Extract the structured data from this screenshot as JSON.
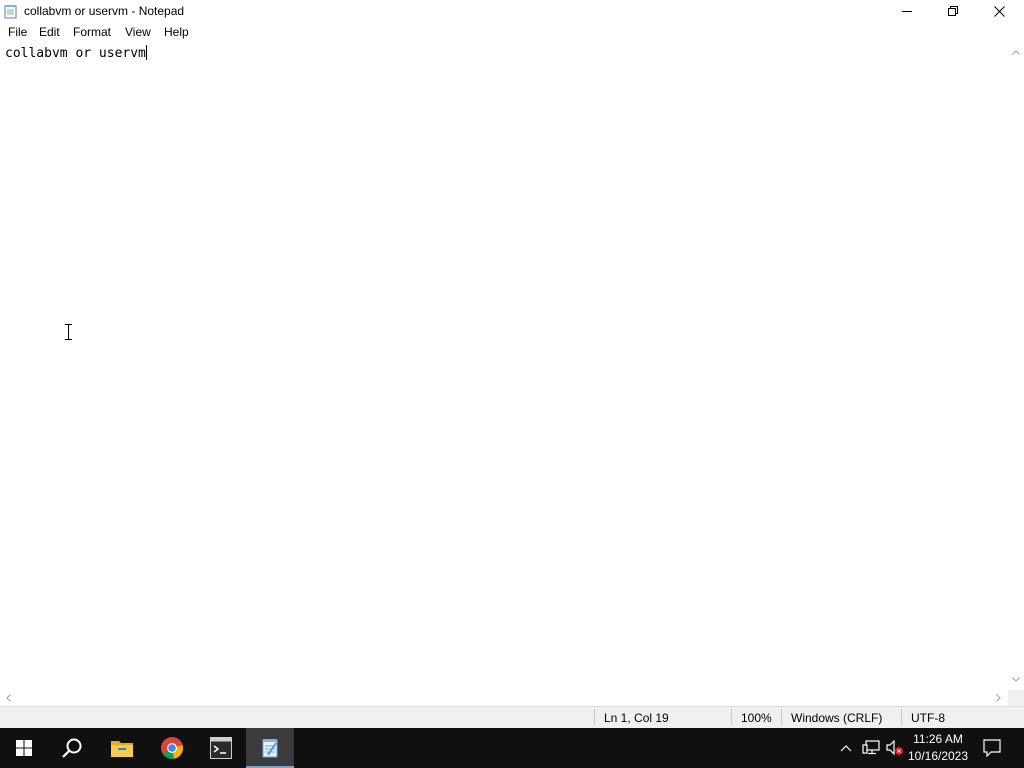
{
  "window": {
    "title": "collabvm or uservm - Notepad",
    "icon": "notepad-icon",
    "controls": [
      "minimize-icon",
      "restore-icon",
      "close-icon"
    ]
  },
  "menu": {
    "items": [
      "File",
      "Edit",
      "Format",
      "View",
      "Help"
    ]
  },
  "editor": {
    "content": "collabvm or uservm"
  },
  "status": {
    "position": "Ln 1, Col 19",
    "zoom": "100%",
    "line_ending": "Windows (CRLF)",
    "encoding": "UTF-8"
  },
  "taskbar": {
    "apps": [
      "windows-start-icon",
      "search-icon",
      "file-explorer-icon",
      "chrome-icon",
      "terminal-app-icon",
      "notepad-icon"
    ],
    "active_app": "notepad-icon",
    "tray": [
      "chevron-up-icon",
      "network-icon",
      "volume-muted-icon",
      "notification-icon"
    ],
    "time": "11:26 AM",
    "date": "10/16/2023"
  },
  "colors": {
    "taskbar": "#101010",
    "active_taskbar_item": "#3b3b3b",
    "status_bar": "#f0f0f0"
  }
}
